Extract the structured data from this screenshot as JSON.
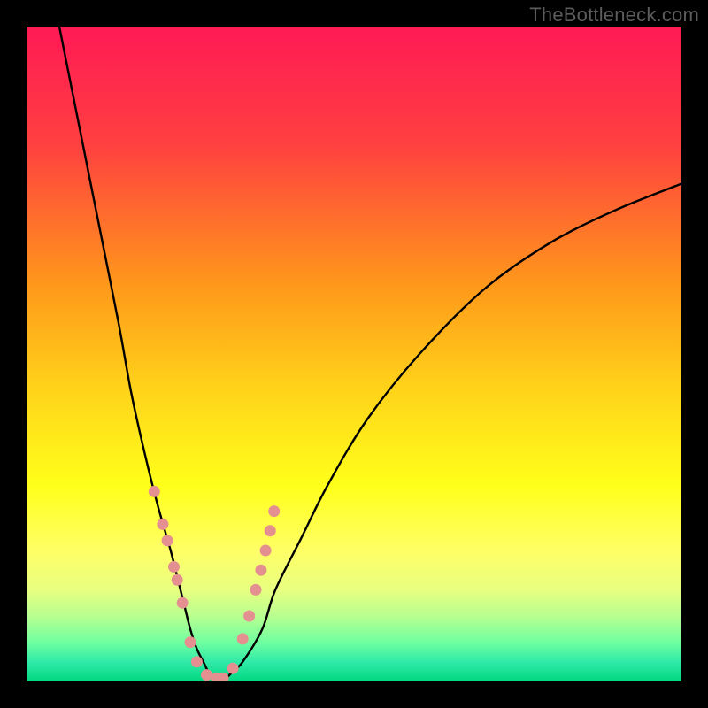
{
  "watermark": "TheBottleneck.com",
  "chart_data": {
    "type": "line",
    "title": "",
    "xlabel": "",
    "ylabel": "",
    "xlim": [
      0,
      100
    ],
    "ylim": [
      0,
      100
    ],
    "grid": false,
    "legend": false,
    "background": {
      "type": "vertical_gradient",
      "stops": [
        {
          "pos": 0.0,
          "color": "#ff1a55"
        },
        {
          "pos": 0.18,
          "color": "#ff4040"
        },
        {
          "pos": 0.4,
          "color": "#ff9a1a"
        },
        {
          "pos": 0.55,
          "color": "#ffd21a"
        },
        {
          "pos": 0.7,
          "color": "#ffff1a"
        },
        {
          "pos": 0.8,
          "color": "#ffff66"
        },
        {
          "pos": 0.86,
          "color": "#e8ff80"
        },
        {
          "pos": 0.9,
          "color": "#b8ff90"
        },
        {
          "pos": 0.94,
          "color": "#70ffa0"
        },
        {
          "pos": 0.97,
          "color": "#30eaa8"
        },
        {
          "pos": 1.0,
          "color": "#00d880"
        }
      ]
    },
    "series": [
      {
        "name": "bottleneck-curve",
        "color": "#000000",
        "x": [
          5,
          8,
          11,
          14,
          16,
          18,
          20,
          22,
          23,
          24,
          25,
          26,
          27,
          28,
          29,
          30,
          31,
          33,
          36,
          38,
          42,
          46,
          52,
          60,
          70,
          80,
          90,
          100
        ],
        "y": [
          100,
          85,
          70,
          55,
          44,
          35,
          27,
          20,
          16,
          12,
          8,
          5,
          3,
          1,
          0,
          0,
          1,
          3,
          8,
          14,
          22,
          30,
          40,
          50,
          60,
          67,
          72,
          76
        ]
      },
      {
        "name": "marker-dots",
        "type": "scatter",
        "color": "#e59090",
        "x": [
          19.5,
          20.8,
          21.5,
          22.5,
          23.0,
          23.8,
          25.0,
          26.0,
          27.5,
          29.0,
          30.0,
          31.5,
          33.0,
          34.0,
          35.0,
          35.8,
          36.5,
          37.2,
          37.8
        ],
        "y": [
          29.0,
          24.0,
          21.5,
          17.5,
          15.5,
          12.0,
          6.0,
          3.0,
          1.0,
          0.5,
          0.5,
          2.0,
          6.5,
          10.0,
          14.0,
          17.0,
          20.0,
          23.0,
          26.0
        ]
      }
    ]
  }
}
